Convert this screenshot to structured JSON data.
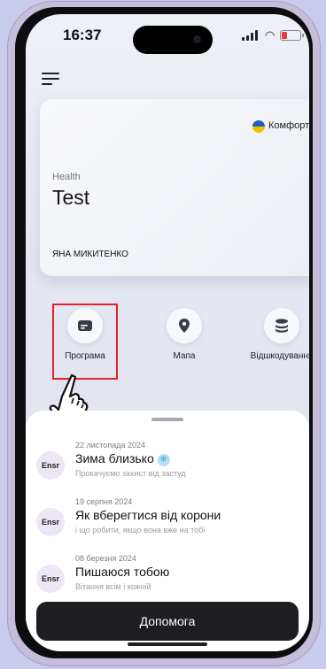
{
  "status_bar": {
    "time": "16:37"
  },
  "card": {
    "tariff": "Комфорт",
    "category": "Health",
    "title": "Test",
    "holder": "ЯНА МИКИТЕНКО"
  },
  "actions": [
    {
      "label": "Програма",
      "icon": "card-icon"
    },
    {
      "label": "Мапа",
      "icon": "map-pin-icon"
    },
    {
      "label": "Відшкодування",
      "icon": "coins-icon"
    }
  ],
  "news": [
    {
      "avatar": "Ensr",
      "date": "22 листопада 2024",
      "title": "Зима близько",
      "subtitle": "Прокачуємо захист від застуд",
      "emoji": "❄"
    },
    {
      "avatar": "Ensr",
      "date": "19 серпня 2024",
      "title": "Як вберегтися від корони",
      "subtitle": "і що робити, якщо вона вже на тобі"
    },
    {
      "avatar": "Ensr",
      "date": "08 березня 2024",
      "title": "Пишаюся тобою",
      "subtitle": "Вітання всім і кожній"
    }
  ],
  "help_button": "Допомога",
  "colors": {
    "highlight": "#e0222a",
    "flag_blue": "#1f5fbf",
    "flag_yellow": "#f2c100",
    "battery_low": "#e53b3b"
  }
}
